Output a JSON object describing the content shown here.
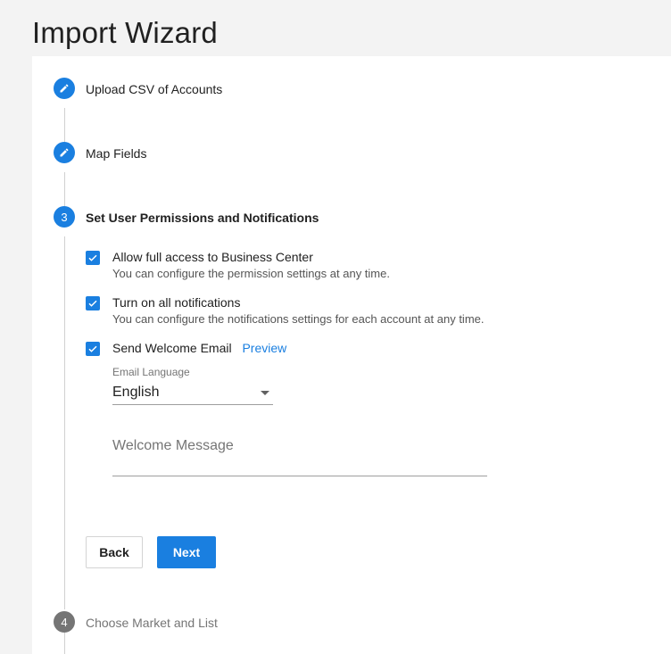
{
  "page": {
    "title": "Import Wizard"
  },
  "steps": [
    {
      "number": "",
      "label": "Upload CSV of Accounts",
      "state": "done",
      "icon": "pencil-icon"
    },
    {
      "number": "",
      "label": "Map Fields",
      "state": "done",
      "icon": "pencil-icon"
    },
    {
      "number": "3",
      "label": "Set User Permissions and Notifications",
      "state": "current"
    },
    {
      "number": "4",
      "label": "Choose Market and List",
      "state": "pending"
    }
  ],
  "options": [
    {
      "title": "Allow full access to Business Center",
      "subtitle": "You can configure the permission settings at any time.",
      "checked": true
    },
    {
      "title": "Turn on all notifications",
      "subtitle": "You can configure the notifications settings for each account at any time.",
      "checked": true
    },
    {
      "title": "Send Welcome Email",
      "link": "Preview",
      "checked": true
    }
  ],
  "email_language": {
    "label": "Email Language",
    "value": "English"
  },
  "welcome_message": {
    "placeholder": "Welcome Message"
  },
  "buttons": {
    "back": "Back",
    "next": "Next"
  },
  "colors": {
    "accent": "#1a7fe0",
    "inactive_step": "#757575"
  }
}
